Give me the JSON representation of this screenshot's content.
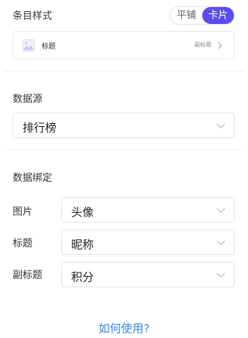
{
  "item_style": {
    "title": "条目样式",
    "options": [
      "平铺",
      "卡片"
    ],
    "selected": "卡片",
    "preview": {
      "title": "标题",
      "subtitle": "副标题",
      "image_icon": "image-placeholder-icon",
      "chevron_icon": "chevron-right-icon"
    }
  },
  "data_source": {
    "title": "数据源",
    "value": "排行榜"
  },
  "data_binding": {
    "title": "数据绑定",
    "rows": [
      {
        "label": "图片",
        "value": "头像"
      },
      {
        "label": "标题",
        "value": "昵称"
      },
      {
        "label": "副标题",
        "value": "积分"
      }
    ]
  },
  "help_link": "如何使用?",
  "colors": {
    "accent": "#5b4cf0",
    "link": "#2f8ae5",
    "border": "#e3e3e8"
  }
}
